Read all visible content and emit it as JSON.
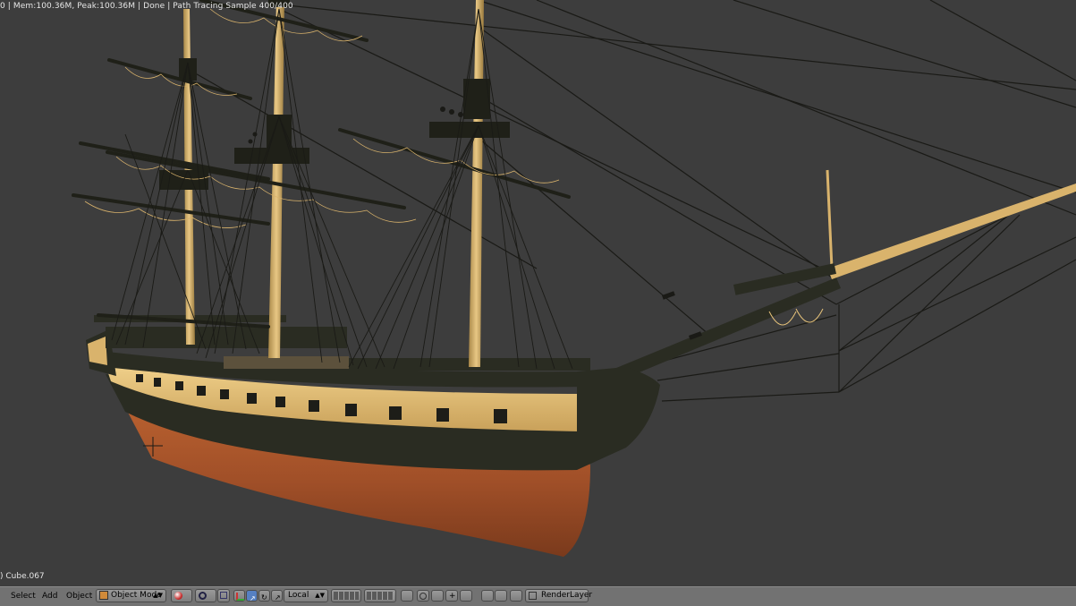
{
  "viewport": {
    "status_text": "0 | Mem:100.36M, Peak:100.36M | Done | Path Tracing Sample 400/400",
    "active_object": ") Cube.067"
  },
  "header": {
    "menus": [
      "Select",
      "Add",
      "Object"
    ],
    "mode": "Object Mode",
    "orientation": "Local",
    "render_layer": "RenderLayer"
  },
  "colors": {
    "viewport_bg": "#3d3d3d",
    "header_bg": "#727272",
    "hull_wood": "#e6c27a",
    "hull_dark": "#2a2c22",
    "hull_copper": "#a8542c",
    "rigging": "#1a1a16"
  }
}
